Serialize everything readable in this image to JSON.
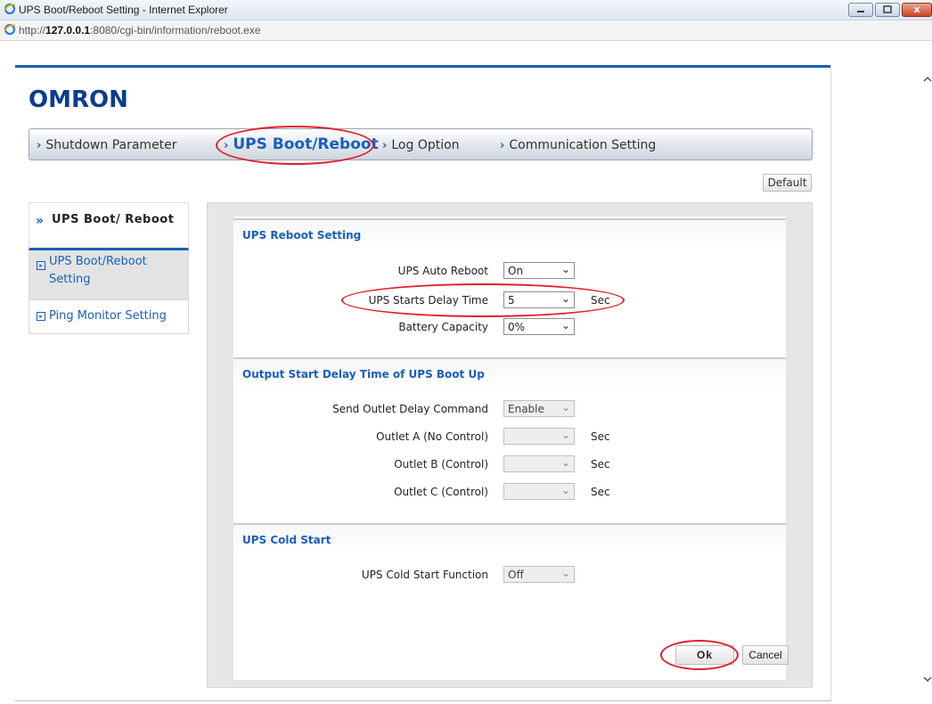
{
  "window": {
    "title": "UPS Boot/Reboot Setting - Internet Explorer",
    "url_prefix": "http://",
    "url_host": "127.0.0.1",
    "url_rest": ":8080/cgi-bin/information/reboot.exe",
    "close_glyph": "x"
  },
  "brand": {
    "logo": "OMRON"
  },
  "nav": {
    "items": [
      {
        "label": "Shutdown Parameter"
      },
      {
        "label": "UPS Boot/Reboot"
      },
      {
        "label": "Log Option"
      },
      {
        "label": "Communication Setting"
      }
    ],
    "chevron": "›"
  },
  "default_button": "Default",
  "sidebar": {
    "header": "UPS Boot/ Reboot",
    "header_glyph": "»",
    "items": [
      {
        "label": "UPS Boot/Reboot Setting"
      },
      {
        "label": "Ping Monitor Setting"
      }
    ]
  },
  "sections": {
    "reboot": {
      "title": "UPS Reboot Setting",
      "fields": [
        {
          "label": "UPS Auto Reboot",
          "value": "On",
          "unit": ""
        },
        {
          "label": "UPS Starts Delay Time",
          "value": "5",
          "unit": "Sec"
        },
        {
          "label": "Battery Capacity",
          "value": "0%",
          "unit": ""
        }
      ]
    },
    "output": {
      "title": "Output Start Delay Time of UPS Boot Up",
      "fields": [
        {
          "label": "Send Outlet Delay Command",
          "value": "Enable",
          "unit": ""
        },
        {
          "label": "Outlet A (No Control)",
          "value": "",
          "unit": "Sec"
        },
        {
          "label": "Outlet B (Control)",
          "value": "",
          "unit": "Sec"
        },
        {
          "label": "Outlet C (Control)",
          "value": "",
          "unit": "Sec"
        }
      ]
    },
    "cold": {
      "title": "UPS Cold Start",
      "fields": [
        {
          "label": "UPS Cold Start Function",
          "value": "Off",
          "unit": ""
        }
      ]
    }
  },
  "buttons": {
    "ok": "Ok",
    "cancel": "Cancel"
  },
  "colors": {
    "accent": "#1a5fb8",
    "highlight": "#e0202a"
  }
}
